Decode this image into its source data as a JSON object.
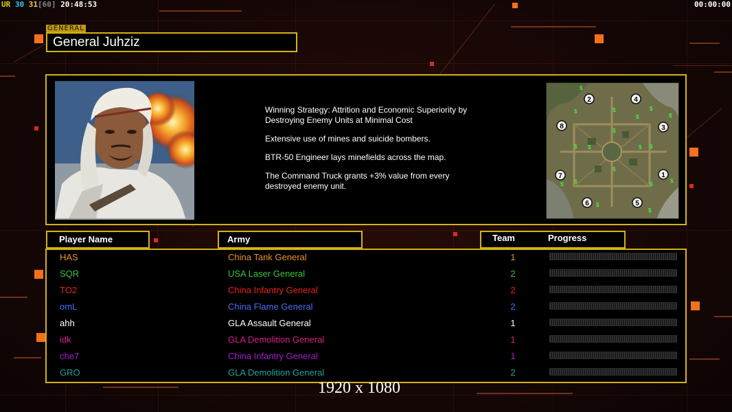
{
  "hud": {
    "ur": "UR",
    "val1": "30",
    "val2": "31",
    "val3": "[60]",
    "clock": "20:48:53",
    "timer": "00:00:00"
  },
  "general": {
    "tag": "GENERAL",
    "name": "General Juhziz"
  },
  "description": [
    "Winning Strategy: Attrition and Economic Superiority by\n Destroying Enemy Units at Minimal Cost",
    "Extensive use of mines and suicide bombers.",
    "BTR-50 Engineer lays minefields across the map.",
    "The Command Truck grants +3% value from every\n destroyed enemy unit."
  ],
  "minimap": {
    "slots": [
      "1",
      "2",
      "3",
      "4",
      "5",
      "6",
      "7",
      "8"
    ]
  },
  "table": {
    "headers": {
      "player": "Player Name",
      "army": "Army",
      "team": "Team",
      "progress": "Progress"
    },
    "rows": [
      {
        "player": "HAS",
        "army": "China Tank General",
        "team": "1",
        "color": "#e8912a"
      },
      {
        "player": "SQR",
        "army": "USA Laser General",
        "team": "2",
        "color": "#3cc43c"
      },
      {
        "player": "TO2",
        "army": "China Infantry General",
        "team": "2",
        "color": "#e8231e"
      },
      {
        "player": "omL",
        "army": "China Flame General",
        "team": "2",
        "color": "#4a6ef2"
      },
      {
        "player": "ahh",
        "army": "GLA Assault General",
        "team": "1",
        "color": "#ffffff"
      },
      {
        "player": "idk",
        "army": "GLA Demolition General",
        "team": "1",
        "color": "#d81e8c"
      },
      {
        "player": "che7",
        "army": "China Infantry General",
        "team": "1",
        "color": "#a020d0"
      },
      {
        "player": "GRO",
        "army": "GLA Demolition General",
        "team": "2",
        "color": "#22a29a"
      }
    ]
  },
  "resolution": "1920 x 1080",
  "colors": {
    "accent": "#d4b316",
    "deco": "#f4701a"
  }
}
